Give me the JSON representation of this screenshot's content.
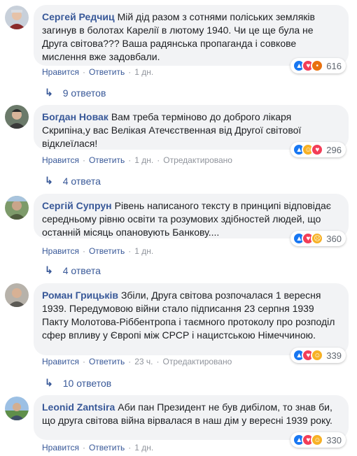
{
  "comments": [
    {
      "author": "Сергей Редчиц",
      "text": "Мій дід разом з сотнями поліських земляків загинув в болотах Карелії в лютому 1940. Чи це ще була не Друга світова??? Ваша радянська пропаганда і совкове мислення вже задовбали.",
      "reactions_count": "616",
      "reactions": [
        "like-icon",
        "love-icon",
        "angry-icon"
      ],
      "like_label": "Нравится",
      "reply_label": "Ответить",
      "time": "1 дн.",
      "edited": "",
      "replies_label": "9 ответов"
    },
    {
      "author": "Богдан Новак",
      "text": "Вам треба терміново до доброго лікаря Скрипіна,у вас Велікая Атечєственная від Другої світової відклеїлася!",
      "reactions_count": "296",
      "reactions": [
        "like-icon",
        "haha-icon",
        "love-icon"
      ],
      "like_label": "Нравится",
      "reply_label": "Ответить",
      "time": "1 дн.",
      "edited": "Отредактировано",
      "replies_label": "4 ответа"
    },
    {
      "author": "Сергій Супрун",
      "text": "Рівень написаного тексту в принципі відповідає середньому рівню освіти та розумових здібностей людей, що останній місяць опановують Банкову....",
      "reactions_count": "360",
      "reactions": [
        "like-icon",
        "love-icon",
        "sad-icon"
      ],
      "like_label": "Нравится",
      "reply_label": "Ответить",
      "time": "1 дн.",
      "edited": "",
      "replies_label": "4 ответа"
    },
    {
      "author": "Роман Грицьків",
      "text": "Збіли, Друга світова розпочалася 1 вересня 1939. Передумовою війни стало підписання 23 серпня 1939 Пакту Молотова-Ріббентропа і таємного протоколу про розподіл сфер впливу у Європі між СРСР і нацистською Німеччиною.",
      "reactions_count": "339",
      "reactions": [
        "like-icon",
        "love-icon",
        "haha-icon"
      ],
      "like_label": "Нравится",
      "reply_label": "Ответить",
      "time": "23 ч.",
      "edited": "Отредактировано",
      "replies_label": "10 ответов"
    },
    {
      "author": "Leonid Zantsira",
      "text": "Аби пан Президент не був дибілом, то знав би, що друга світова війна вірвалася в наш дім у вересні 1939 року.",
      "reactions_count": "330",
      "reactions": [
        "like-icon",
        "love-icon",
        "haha-icon"
      ],
      "like_label": "Нравится",
      "reply_label": "Ответить",
      "time": "1 дн.",
      "edited": "",
      "replies_label": ""
    }
  ],
  "colors": {
    "link": "#385898",
    "bubble": "#f2f3f5",
    "meta": "#90949c",
    "like": "#1877f2",
    "love": "#f33e58",
    "haha": "#f7b125",
    "angry": "#e9710f"
  },
  "reply_arrow_icon": "reply-arrow-icon"
}
